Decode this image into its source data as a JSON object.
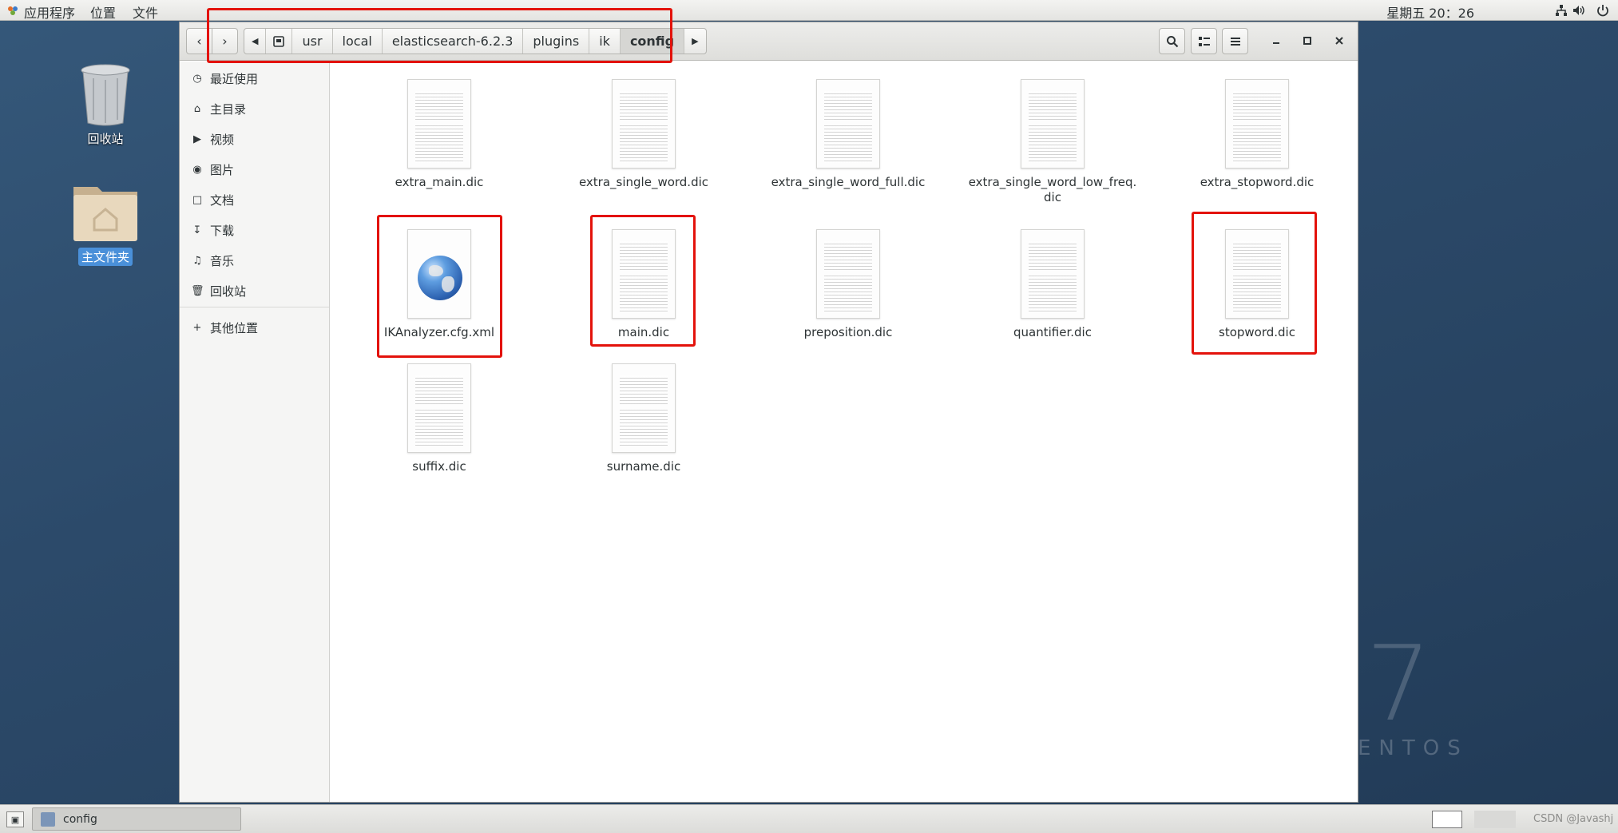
{
  "top_panel": {
    "applications": "应用程序",
    "places": "位置",
    "files": "文件",
    "clock": "星期五 20：26"
  },
  "desktop": {
    "trash_label": "回收站",
    "home_label": "主文件夹",
    "watermark_number": "7",
    "watermark_text": "ENTOS"
  },
  "window": {
    "path": [
      "usr",
      "local",
      "elasticsearch-6.2.3",
      "plugins",
      "ik",
      "config"
    ],
    "current_folder": "config"
  },
  "sidebar": {
    "items": [
      {
        "label": "最近使用",
        "icon": "clock-icon"
      },
      {
        "label": "主目录",
        "icon": "home-icon"
      },
      {
        "label": "视频",
        "icon": "video-icon"
      },
      {
        "label": "图片",
        "icon": "camera-icon"
      },
      {
        "label": "文档",
        "icon": "document-icon"
      },
      {
        "label": "下载",
        "icon": "download-icon"
      },
      {
        "label": "音乐",
        "icon": "music-icon"
      },
      {
        "label": "回收站",
        "icon": "trash-icon"
      }
    ],
    "other_locations": "其他位置"
  },
  "files": [
    {
      "name": "extra_main.dic",
      "type": "text"
    },
    {
      "name": "extra_single_word.dic",
      "type": "text"
    },
    {
      "name": "extra_single_word_full.dic",
      "type": "text"
    },
    {
      "name": "extra_single_word_low_freq.dic",
      "type": "text"
    },
    {
      "name": "extra_stopword.dic",
      "type": "text"
    },
    {
      "name": "IKAnalyzer.cfg.xml",
      "type": "xml"
    },
    {
      "name": "main.dic",
      "type": "text"
    },
    {
      "name": "preposition.dic",
      "type": "text"
    },
    {
      "name": "quantifier.dic",
      "type": "text"
    },
    {
      "name": "stopword.dic",
      "type": "text"
    },
    {
      "name": "suffix.dic",
      "type": "text"
    },
    {
      "name": "surname.dic",
      "type": "text"
    }
  ],
  "taskbar": {
    "task_label": "config",
    "watermark": "CSDN @Javashj"
  }
}
